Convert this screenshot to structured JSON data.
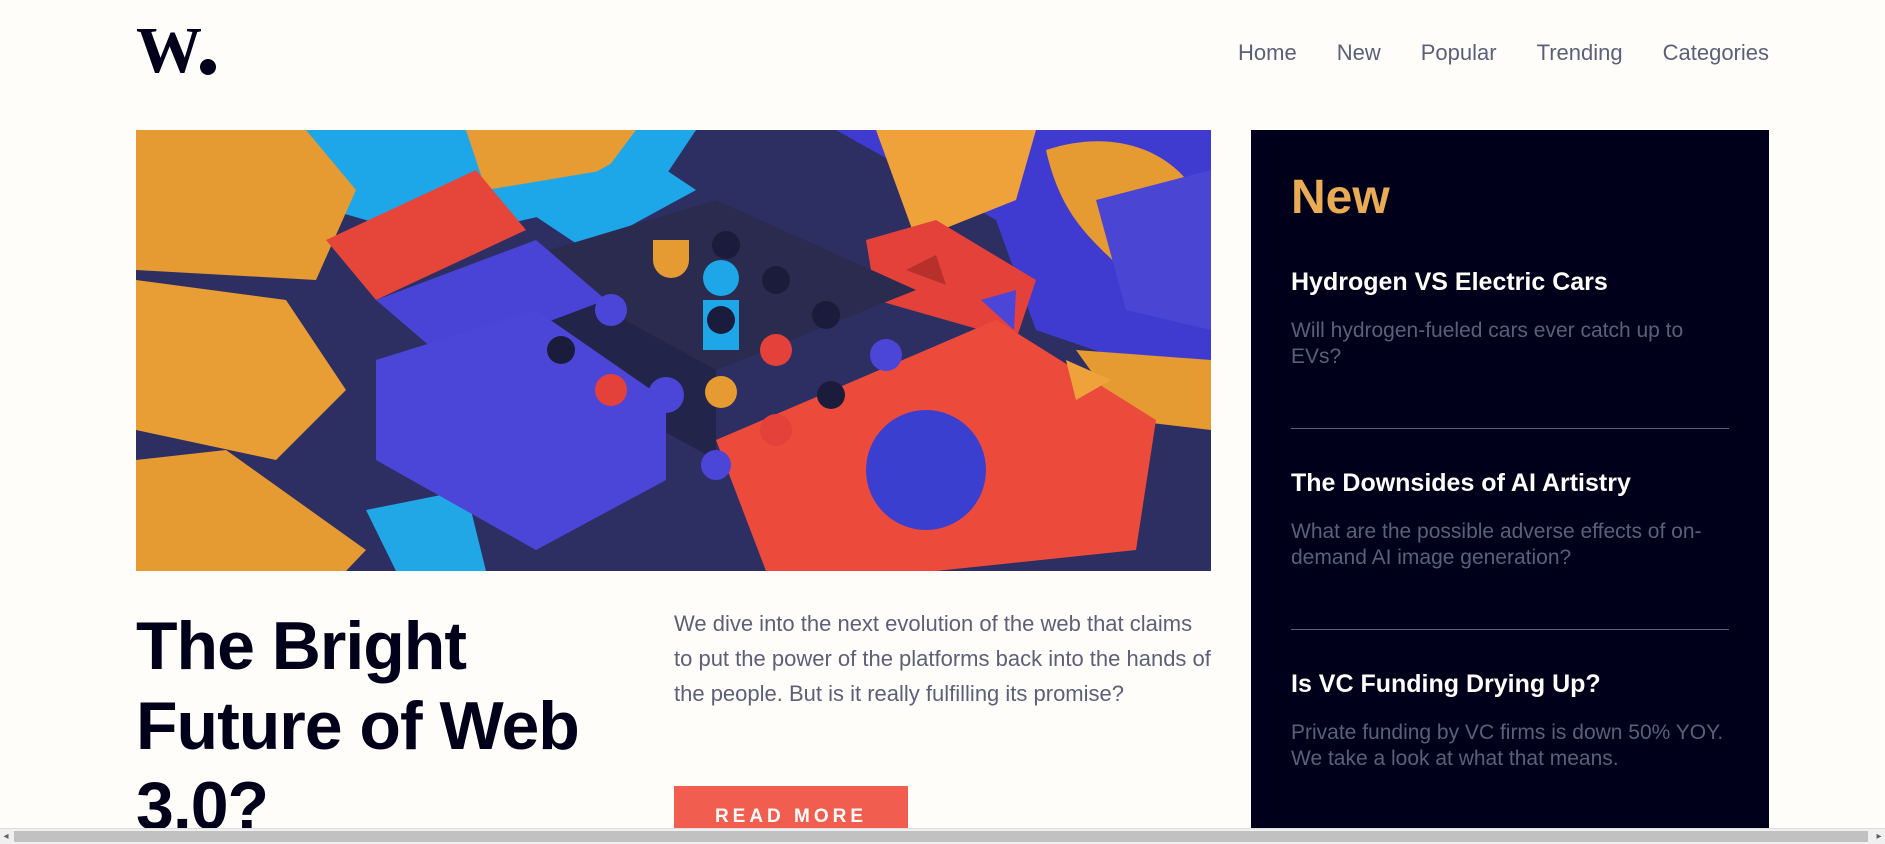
{
  "header": {
    "logo_text": "W.",
    "nav": [
      "Home",
      "New",
      "Popular",
      "Trending",
      "Categories"
    ]
  },
  "hero": {
    "title": "The Bright Future of Web 3.0?",
    "description": "We dive into the next evolution of the web that claims to put the power of the platforms back into the hands of the people. But is it really fulfilling its promise?",
    "button_label": "READ MORE"
  },
  "sidebar": {
    "title": "New",
    "articles": [
      {
        "title": "Hydrogen VS Electric Cars",
        "description": "Will hydrogen-fueled cars ever catch up to EVs?"
      },
      {
        "title": "The Downsides of AI Artistry",
        "description": "What are the possible adverse effects of on-demand AI image generation?"
      },
      {
        "title": "Is VC Funding Drying Up?",
        "description": "Private funding by VC firms is down 50% YOY. We take a look at what that means."
      }
    ]
  },
  "colors": {
    "accent": "#f15e50",
    "sidebar_bg": "#00001a",
    "sidebar_heading": "#e9ab53",
    "text_muted": "#5d5f79",
    "background": "#fffdfa"
  },
  "icons": {
    "scroll_left": "triangle-left-icon",
    "scroll_right": "triangle-right-icon"
  }
}
